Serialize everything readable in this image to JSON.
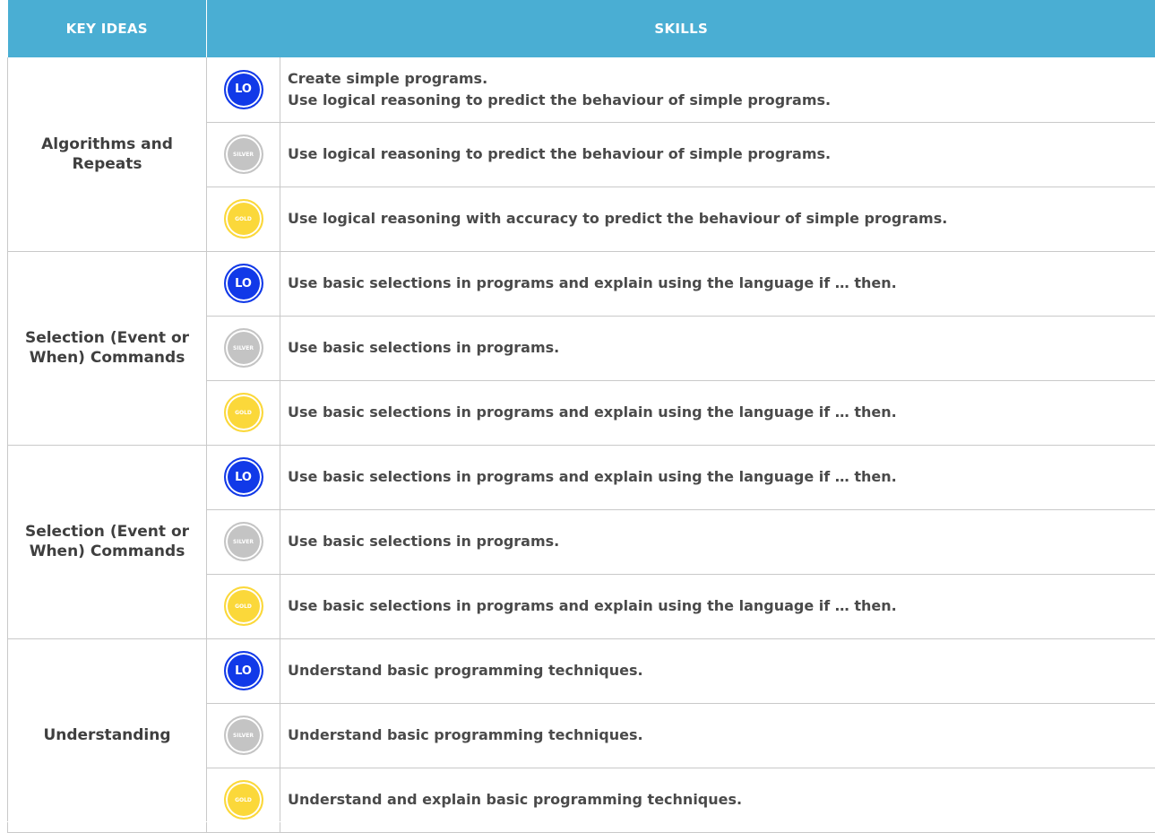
{
  "header": {
    "key_ideas": "KEY IDEAS",
    "skills": "SKILLS"
  },
  "badges": {
    "lo": "LO",
    "silver": "SILVER",
    "gold": "GOLD"
  },
  "colors": {
    "header_bg": "#4aaed3",
    "lo": "#1139e8",
    "silver": "#c4c4c4",
    "gold": "#fbd83a"
  },
  "groups": [
    {
      "key_idea": "Algorithms and Repeats",
      "rows": [
        {
          "level": "LO",
          "skill_lines": [
            "Create simple programs.",
            "Use logical reasoning to predict the behaviour of simple programs."
          ]
        },
        {
          "level": "SILVER",
          "skill_lines": [
            "Use logical reasoning to predict the behaviour of simple programs."
          ]
        },
        {
          "level": "GOLD",
          "skill_lines": [
            "Use logical reasoning with accuracy to predict the behaviour of simple programs."
          ]
        }
      ]
    },
    {
      "key_idea": "Selection (Event or When) Commands",
      "rows": [
        {
          "level": "LO",
          "skill_lines": [
            "Use basic selections in programs and explain using the language if … then."
          ]
        },
        {
          "level": "SILVER",
          "skill_lines": [
            "Use basic selections in programs."
          ]
        },
        {
          "level": "GOLD",
          "skill_lines": [
            "Use basic selections in programs and explain using the language if … then."
          ]
        }
      ]
    },
    {
      "key_idea": "Selection (Event or When) Commands",
      "rows": [
        {
          "level": "LO",
          "skill_lines": [
            "Use basic selections in programs and explain using the language if … then."
          ]
        },
        {
          "level": "SILVER",
          "skill_lines": [
            "Use basic selections in programs."
          ]
        },
        {
          "level": "GOLD",
          "skill_lines": [
            "Use basic selections in programs and explain using the language if … then."
          ]
        }
      ]
    },
    {
      "key_idea": "Understanding",
      "rows": [
        {
          "level": "LO",
          "skill_lines": [
            "Understand basic programming techniques."
          ]
        },
        {
          "level": "SILVER",
          "skill_lines": [
            "Understand basic programming techniques."
          ]
        },
        {
          "level": "GOLD",
          "skill_lines": [
            "Understand and explain basic programming techniques."
          ]
        }
      ]
    }
  ]
}
